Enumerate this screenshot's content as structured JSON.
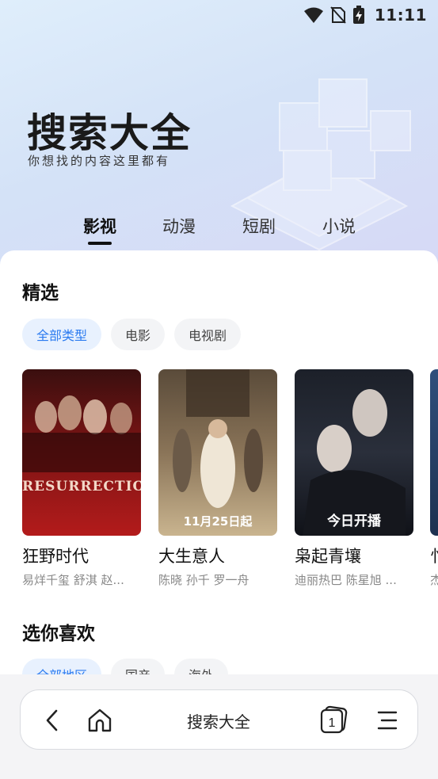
{
  "status_bar": {
    "time": "11:11"
  },
  "hero": {
    "title": "搜索大全",
    "subtitle": "你想找的内容这里都有"
  },
  "category_tabs": [
    {
      "label": "影视",
      "active": true
    },
    {
      "label": "动漫",
      "active": false
    },
    {
      "label": "短剧",
      "active": false
    },
    {
      "label": "小说",
      "active": false
    }
  ],
  "featured": {
    "title": "精选",
    "chips": [
      {
        "label": "全部类型",
        "active": true
      },
      {
        "label": "电影",
        "active": false
      },
      {
        "label": "电视剧",
        "active": false
      }
    ],
    "items": [
      {
        "title": "狂野时代",
        "cast": "易烊千玺 舒淇 赵...",
        "poster_text": "RESURRECTION"
      },
      {
        "title": "大生意人",
        "cast": "陈晓 孙千 罗一舟",
        "poster_text": "11月25日起"
      },
      {
        "title": "枭起青壤",
        "cast": "迪丽热巴 陈星旭 ...",
        "poster_text": "今日开播"
      },
      {
        "title": "忄",
        "cast": "杰",
        "poster_text": ""
      }
    ]
  },
  "recommend": {
    "title": "选你喜欢",
    "chips": [
      {
        "label": "全部地区",
        "active": true
      },
      {
        "label": "国产",
        "active": false
      },
      {
        "label": "海外",
        "active": false
      }
    ]
  },
  "toolbar": {
    "title": "搜索大全",
    "tab_count": "1"
  }
}
